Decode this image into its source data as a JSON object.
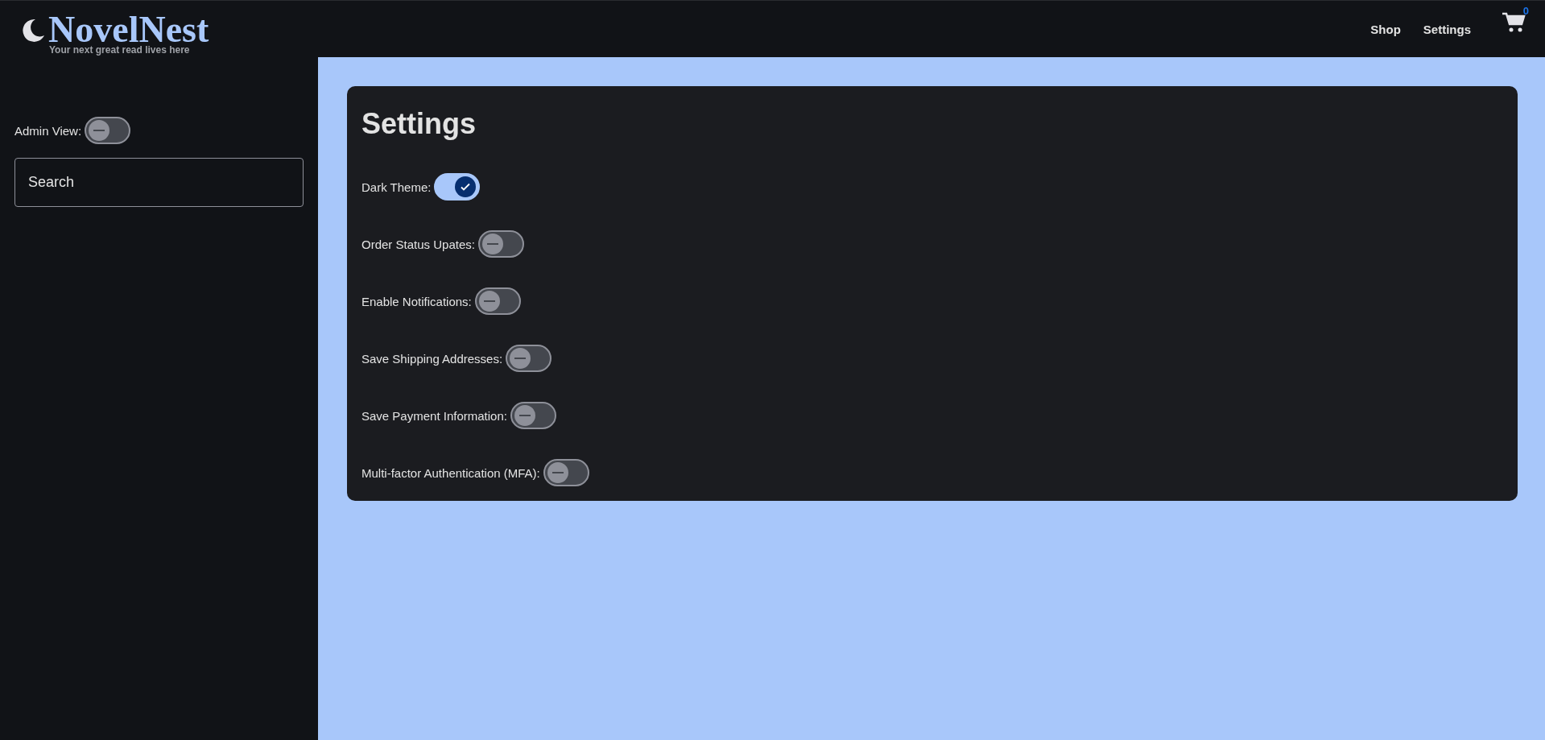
{
  "header": {
    "logo": "NovelNest",
    "tagline": "Your next great read lives here",
    "nav": [
      "Shop",
      "Settings"
    ],
    "cart_count": "0"
  },
  "sidebar": {
    "admin_view": {
      "label": "Admin View:",
      "on": false
    },
    "search": {
      "placeholder": "Search"
    }
  },
  "settings": {
    "title": "Settings",
    "options": [
      {
        "label": "Dark Theme:",
        "on": true
      },
      {
        "label": "Order Status Upates:",
        "on": false
      },
      {
        "label": "Enable Notifications:",
        "on": false
      },
      {
        "label": "Save Shipping Addresses:",
        "on": false
      },
      {
        "label": "Save Payment Information:",
        "on": false
      },
      {
        "label": "Multi-factor Authentication (MFA):",
        "on": false
      }
    ]
  }
}
